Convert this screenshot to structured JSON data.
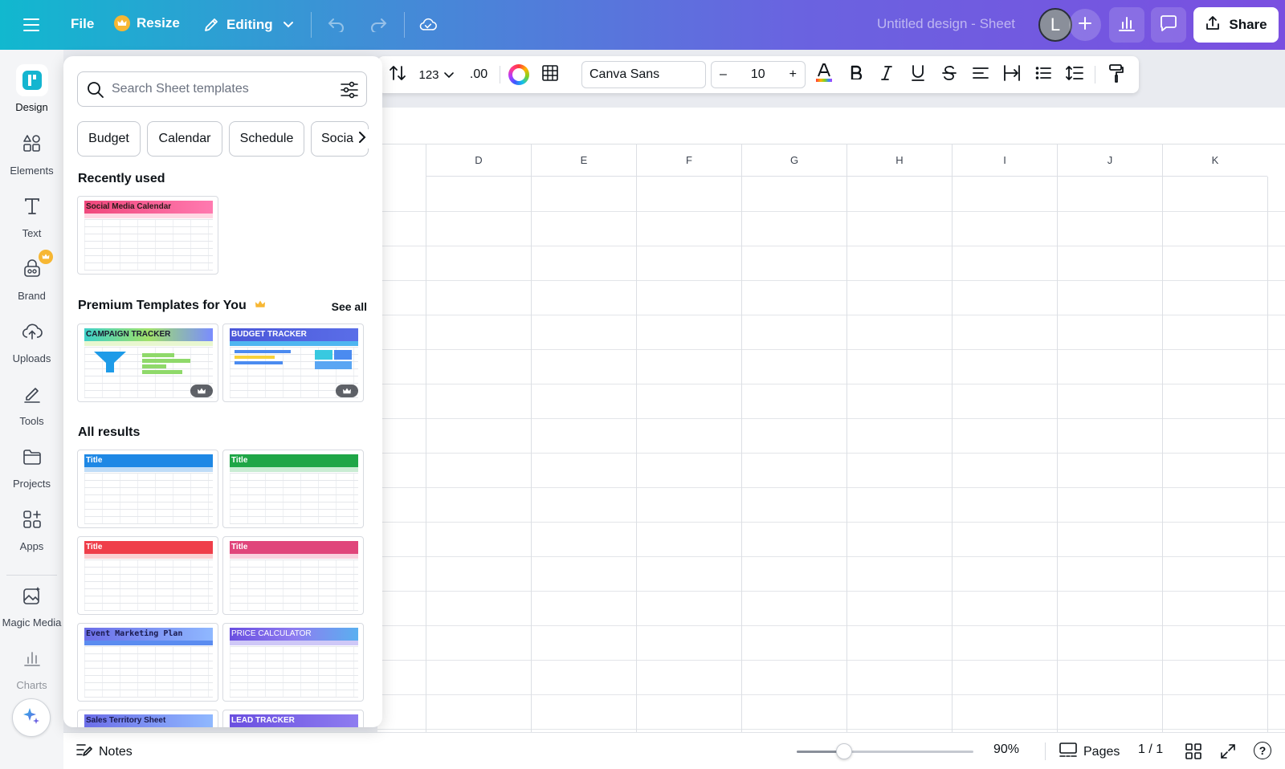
{
  "topbar": {
    "file_label": "File",
    "resize_label": "Resize",
    "editing_label": "Editing",
    "design_title": "Untitled design - Sheet",
    "avatar_initial": "L",
    "share_label": "Share"
  },
  "rail": {
    "items": [
      {
        "label": "Design",
        "icon": "design-icon"
      },
      {
        "label": "Elements",
        "icon": "elements-icon"
      },
      {
        "label": "Text",
        "icon": "text-icon"
      },
      {
        "label": "Brand",
        "icon": "brand-icon"
      },
      {
        "label": "Uploads",
        "icon": "uploads-icon"
      },
      {
        "label": "Tools",
        "icon": "tools-icon"
      },
      {
        "label": "Projects",
        "icon": "projects-icon"
      },
      {
        "label": "Apps",
        "icon": "apps-icon"
      },
      {
        "label": "Magic Media",
        "icon": "magic-media-icon"
      },
      {
        "label": "Charts",
        "icon": "charts-icon"
      }
    ]
  },
  "panel": {
    "search_placeholder": "Search Sheet templates",
    "chips": [
      "Budget",
      "Calendar",
      "Schedule",
      "Social"
    ],
    "recently_used_title": "Recently used",
    "recent_templates": [
      {
        "title": "Social Media Calendar",
        "color": "#f0487c"
      }
    ],
    "premium_title": "Premium Templates for You",
    "see_all_label": "See all",
    "premium_templates": [
      {
        "title": "CAMPAIGN TRACKER",
        "color": "#3ed0c8"
      },
      {
        "title": "BUDGET TRACKER",
        "color": "#4b57d9"
      }
    ],
    "all_results_title": "All results",
    "results": [
      {
        "title": "Title",
        "color": "#1e88e5"
      },
      {
        "title": "Title",
        "color": "#1fa647"
      },
      {
        "title": "Title",
        "color": "#ef3e4a"
      },
      {
        "title": "Title",
        "color": "#e0457b"
      },
      {
        "title": "Event Marketing Plan",
        "color": "#6c6ee8"
      },
      {
        "title": "PRICE CALCULATOR",
        "color": "#6a4fe0"
      },
      {
        "title": "Sales Territory Sheet",
        "color": "#6c6ee8"
      },
      {
        "title": "LEAD TRACKER",
        "color": "#6a4fe0"
      }
    ]
  },
  "toolbar": {
    "number_format": "123",
    "decimal_label": ".00",
    "font_name": "Canva Sans",
    "font_size": "10",
    "minus_label": "–",
    "plus_label": "+"
  },
  "sheet": {
    "columns": [
      "D",
      "E",
      "F",
      "G",
      "H",
      "I",
      "J",
      "K"
    ]
  },
  "bottombar": {
    "notes_label": "Notes",
    "zoom_label": "90%",
    "zoom_level_fraction": 0.27,
    "pages_label": "Pages",
    "page_count": "1 / 1",
    "help_label": "?"
  },
  "colors": {
    "topbar_gradient_start": "#11b8cf",
    "topbar_gradient_end": "#7a4fe0",
    "crown": "#f7b733"
  }
}
